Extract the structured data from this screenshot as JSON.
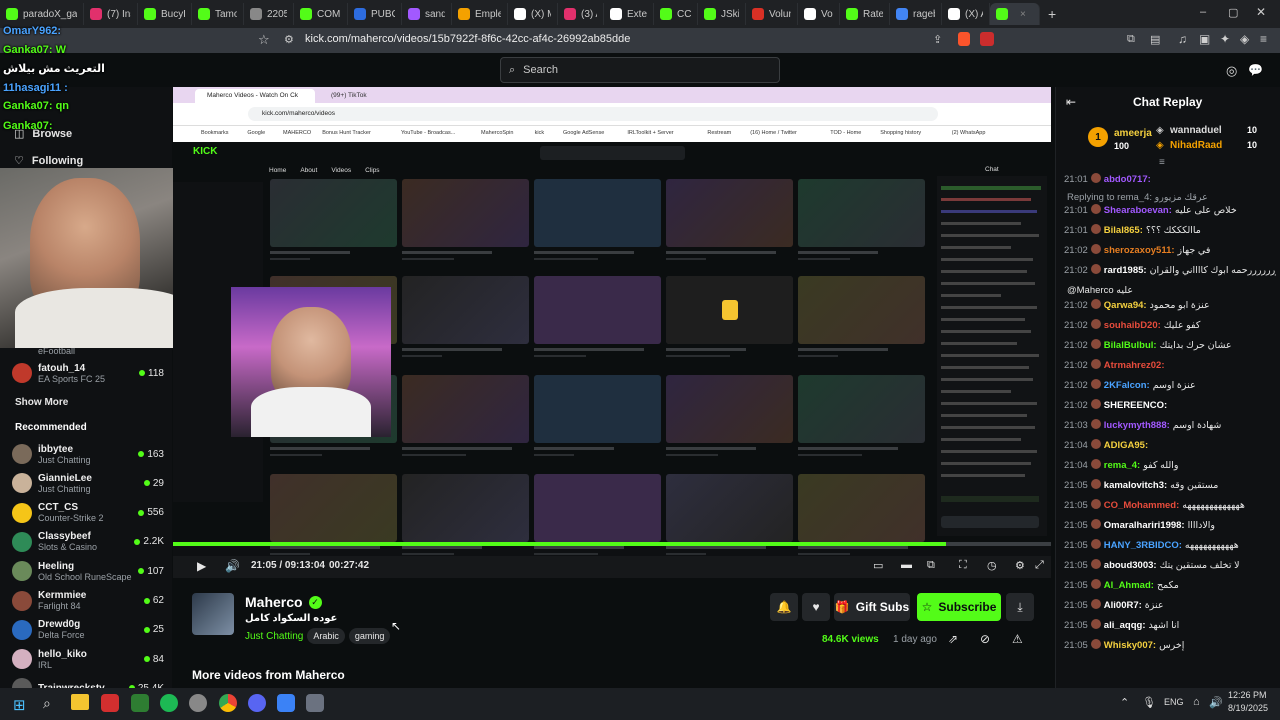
{
  "tabs": [
    {
      "label": "paradoX_gamer",
      "color": "#53fc18"
    },
    {
      "label": "(7) Ins",
      "color": "#e1306c"
    },
    {
      "label": "BucyP",
      "color": "#53fc18"
    },
    {
      "label": "Tamo",
      "color": "#53fc18"
    },
    {
      "label": "2205",
      "color": "#888888"
    },
    {
      "label": "COM",
      "color": "#53fc18"
    },
    {
      "label": "PUBG",
      "color": "#2d6cdf"
    },
    {
      "label": "sandr",
      "color": "#a259ff"
    },
    {
      "label": "Emple",
      "color": "#f4a100"
    },
    {
      "label": "(X) Me",
      "color": "#ffffff"
    },
    {
      "label": "(3) Ar",
      "color": "#e1306c"
    },
    {
      "label": "Extern",
      "color": "#ffffff"
    },
    {
      "label": "CC",
      "color": "#53fc18"
    },
    {
      "label": "JSkill",
      "color": "#53fc18"
    },
    {
      "label": "Volum",
      "color": "#d93025"
    },
    {
      "label": "Vo",
      "color": "#ffffff"
    },
    {
      "label": "Rated",
      "color": "#53fc18"
    },
    {
      "label": "rageb",
      "color": "#4285f4"
    },
    {
      "label": "(X) Ac",
      "color": "#ffffff"
    },
    {
      "label": "",
      "color": "#53fc18",
      "active": true
    }
  ],
  "address": {
    "url": "kick.com/maherco/videos/15b7922f-8f6c-42cc-af4c-26992ab85dde"
  },
  "search": {
    "placeholder": "Search"
  },
  "sidebar": {
    "browse": "Browse",
    "following": "Following",
    "category_top": "eFootball",
    "followed": [
      {
        "name": "fatouh_14",
        "category": "EA Sports FC 25",
        "viewers": "118",
        "color": "#c0392b"
      }
    ],
    "show_more": "Show More",
    "recommended_title": "Recommended",
    "recommended": [
      {
        "name": "ibbytee",
        "category": "Just Chatting",
        "viewers": "163",
        "color": "#7a6a5a"
      },
      {
        "name": "GiannieLee",
        "category": "Just Chatting",
        "viewers": "29",
        "color": "#c9b29a"
      },
      {
        "name": "CCT_CS",
        "category": "Counter-Strike 2",
        "viewers": "556",
        "color": "#f5c518"
      },
      {
        "name": "Classybeef",
        "category": "Slots & Casino",
        "viewers": "2.2K",
        "color": "#2e8b57"
      },
      {
        "name": "Heeling",
        "category": "Old School RuneScape",
        "viewers": "107",
        "color": "#6a8a5a"
      },
      {
        "name": "Kermmiee",
        "category": "Farlight 84",
        "viewers": "62",
        "color": "#8a4a3a"
      },
      {
        "name": "Drewd0g",
        "category": "Delta Force",
        "viewers": "25",
        "color": "#2a6abf"
      },
      {
        "name": "hello_kiko",
        "category": "IRL",
        "viewers": "84",
        "color": "#d4b0c0"
      },
      {
        "name": "Trainwreckstv",
        "category": "",
        "viewers": "25.4K",
        "color": "#5a5a5a"
      }
    ]
  },
  "overlay_chat": [
    {
      "text": "OmarY962:",
      "color": "#4aa3ff"
    },
    {
      "text": "Ganka07: W",
      "color": "#53fc18"
    },
    {
      "text": "التعريث مش بيلاش",
      "color": "#ffffff"
    },
    {
      "text": "11hasagi11 :",
      "color": "#4aa3ff"
    },
    {
      "text": "Ganka07: qn",
      "color": "#53fc18"
    },
    {
      "text": "Ganka07:",
      "color": "#53fc18"
    }
  ],
  "inner_browser": {
    "tab1": "Maherco Videos - Watch On Ck",
    "tab2": "(99+) TikTok",
    "url": "kick.com/maherco/videos",
    "bookmarks": [
      "Bookmarks",
      "Google",
      "MAHERCO",
      "Bonus Hunt Tracker",
      "YouTube - Broadcas...",
      "MahercoSpin",
      "kick",
      "Google AdSense",
      "IRLToolkit + Server",
      "Restream",
      "(16) Home / Twitter",
      "TOD - Home",
      "Shopping history",
      "(2) WhatsApp",
      "All Bookmarks"
    ],
    "nav": [
      "Home",
      "About",
      "Videos",
      "Clips"
    ],
    "chat_title": "Chat"
  },
  "player": {
    "time": "21:05 / 09:13:04",
    "elapsed": "00:27:42",
    "progress": 0.88
  },
  "channel": {
    "name": "Maherco",
    "title": "عوده السكواد كامل",
    "category": "Just Chatting",
    "tags": [
      "Arabic",
      "gaming"
    ],
    "views": "84.6K views",
    "age": "1 day ago",
    "gift_label": "Gift Subs",
    "subscribe_label": "Subscribe",
    "more_videos": "More videos from Maherco"
  },
  "chat": {
    "title": "Chat Replay",
    "pinned": [
      {
        "name": "ameerja",
        "amount": "100"
      },
      {
        "name": "wannaduel",
        "amount": "10"
      },
      {
        "name": "NihadRaad",
        "amount": "10"
      }
    ],
    "messages": [
      {
        "time": "21:01",
        "user": "abdo0717:",
        "text": "",
        "color": "#a259ff"
      },
      {
        "time": "",
        "user": "",
        "text": "Replying to rema_4: عرقك مزيورو",
        "color": "#9aa0a6"
      },
      {
        "time": "21:01",
        "user": "Shearaboevan:",
        "text": "خلاص على عليه",
        "color": "#a259ff"
      },
      {
        "time": "21:01",
        "user": "Bilal865:",
        "text": "ماالكككك ؟؟؟",
        "color": "#f4d03f"
      },
      {
        "time": "21:02",
        "user": "sherozaxoy511:",
        "text": "في جهاز",
        "color": "#e67e22"
      },
      {
        "time": "21:02",
        "user": "rard1985:",
        "text": "ررررررررحمه ابوك كااااني والقران",
        "color": "#ffffff"
      },
      {
        "time": "",
        "user": "",
        "text": "@Maherco عليه",
        "color": "#e6e6e6"
      },
      {
        "time": "21:02",
        "user": "Qarwa94:",
        "text": "عنزة ابو محمود",
        "color": "#f4d03f"
      },
      {
        "time": "21:02",
        "user": "souhaibD20:",
        "text": "كفو عليك",
        "color": "#e74c3c"
      },
      {
        "time": "21:02",
        "user": "BilalBulbul:",
        "text": "عشان حرك بدايتك",
        "color": "#53fc18"
      },
      {
        "time": "21:02",
        "user": "Atrmahrez02:",
        "text": "",
        "color": "#e74c3c"
      },
      {
        "time": "21:02",
        "user": "2KFalcon:",
        "text": "عنزة اوسم",
        "color": "#4aa3ff"
      },
      {
        "time": "21:02",
        "user": "SHEREENCO:",
        "text": "",
        "color": "#ffffff"
      },
      {
        "time": "21:03",
        "user": "luckymyth888:",
        "text": "شهادة اوسم",
        "color": "#a259ff"
      },
      {
        "time": "21:04",
        "user": "ADIGA95:",
        "text": "",
        "color": "#f4d03f"
      },
      {
        "time": "21:04",
        "user": "rema_4:",
        "text": "والله كفو",
        "color": "#53fc18"
      },
      {
        "time": "21:05",
        "user": "kamalovitch3:",
        "text": "مستقين وقه",
        "color": "#ffffff"
      },
      {
        "time": "21:05",
        "user": "CO_Mohammed:",
        "text": "هههههههههههههه",
        "color": "#e74c3c"
      },
      {
        "time": "21:05",
        "user": "Omaralhariri1998:",
        "text": "والاداااا",
        "color": "#ffffff"
      },
      {
        "time": "21:05",
        "user": "HANY_3RBIDCO:",
        "text": "هههههههههههه",
        "color": "#4aa3ff"
      },
      {
        "time": "21:05",
        "user": "aboud3003:",
        "text": "لا تخلف مستقين يتك",
        "color": "#ffffff"
      },
      {
        "time": "21:05",
        "user": "Al_Ahmad:",
        "text": "مكمح",
        "color": "#53fc18"
      },
      {
        "time": "21:05",
        "user": "Ali00R7:",
        "text": "عنزة",
        "color": "#ffffff"
      },
      {
        "time": "21:05",
        "user": "ali_aqqg:",
        "text": "انا اشهد",
        "color": "#ffffff"
      },
      {
        "time": "21:05",
        "user": "Whisky007:",
        "text": "إخرس",
        "color": "#f4d03f"
      }
    ]
  },
  "taskbar": {
    "time": "12:26 PM",
    "date": "8/19/2025",
    "lang": "ENG"
  }
}
